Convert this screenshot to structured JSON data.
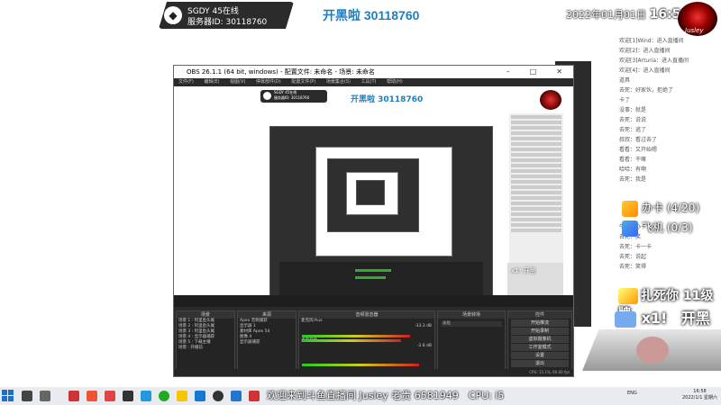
{
  "overlay": {
    "server_line1": "SGDY 45在线",
    "server_line2": "服务器ID: 30118760",
    "stream_title": "开黑啦 30118760",
    "date": "2022年01月01日",
    "time": "16:58:25",
    "logo_text": "Jusley"
  },
  "chat": {
    "lines": [
      {
        "tag": "",
        "text": "欢迎[1]Wind：进入直播间"
      },
      {
        "tag": "",
        "text": "欢迎[2]：进入直播间"
      },
      {
        "tag": "",
        "text": "欢迎[3]Arturia：进入直播间"
      },
      {
        "tag": "",
        "text": "欢迎[4]：进入直播间"
      },
      {
        "tag": "",
        "text": "道具"
      },
      {
        "tag": "",
        "text": "去死：好家伙，拒绝了"
      },
      {
        "tag": "",
        "text": "卡了"
      },
      {
        "tag": "",
        "text": "没事：就是"
      },
      {
        "tag": "",
        "text": "去死：说说"
      },
      {
        "tag": "",
        "text": "去死：逃了"
      },
      {
        "tag": "",
        "text": "叔叔：看过去了"
      },
      {
        "tag": "",
        "text": "看看：又开始嗯"
      },
      {
        "tag": "",
        "text": "看看：干嘛"
      },
      {
        "tag": "",
        "text": "哈哈：有啊"
      },
      {
        "tag": "",
        "text": "去死：我是"
      }
    ],
    "card1_label": "办卡 (4/20)",
    "card2_label": "飞机 (0/3)",
    "lower_lines": [
      "牛逼：办卡",
      "去死：笑",
      "去死：卡一卡",
      "去死：说起",
      "去死：笑得"
    ],
    "kill_banner": "扎死你 11级牌",
    "x1_label": "x1!",
    "x1_action": "开黑"
  },
  "obs": {
    "title": "OBS 26.1.1 (64 bit, windows) - 配置文件: 未命名 - 场景: 未命名",
    "menu": [
      "文件(F)",
      "编辑(E)",
      "视图(V)",
      "停靠部件(D)",
      "配置文件(P)",
      "场景集合(S)",
      "工具(T)",
      "帮助(H)"
    ],
    "inner_title": "开黑啦 30118760",
    "inner_badge_line1": "SGDY 45在线",
    "inner_badge_line2": "服务器ID: 30118760",
    "docks": {
      "scenes_header": "场景",
      "scenes": [
        "场景 1 : 阿里鱼头尾",
        "场景 2 : 阿里鱼头尾",
        "场景 3 : 阿里鱼头尾",
        "场景 4 : 显示器捕获",
        "场景 5 : 下载主播",
        "场景 : 开播前"
      ],
      "sources_header": "来源",
      "sources": [
        "Apex 音频捕获",
        "显示器 1",
        "素材库 Apex 54",
        "图像 4",
        "显示器捕获"
      ],
      "mixer_header": "音频混音器",
      "mixer_tracks": [
        "麦克风/Aux",
        "桌面音频"
      ],
      "mixer_levels": [
        "-33.3 dB",
        "-2.8 dB"
      ],
      "transitions_header": "场景转场",
      "transition_value": "淡化",
      "controls_header": "控件",
      "controls": [
        "开始推流",
        "开始录制",
        "虚拟摄像机",
        "工作室模式",
        "设置",
        "退出"
      ],
      "status": "CPU: 15.1%, 60.00 fps"
    }
  },
  "taskbar": {
    "ticker": "欢迎来到斗鱼直播间 Jusley 老贵 6581949　CPU: i5",
    "tray_lang": "ENG",
    "clock_time": "16:58",
    "clock_date": "2022/1/1 星期六"
  }
}
